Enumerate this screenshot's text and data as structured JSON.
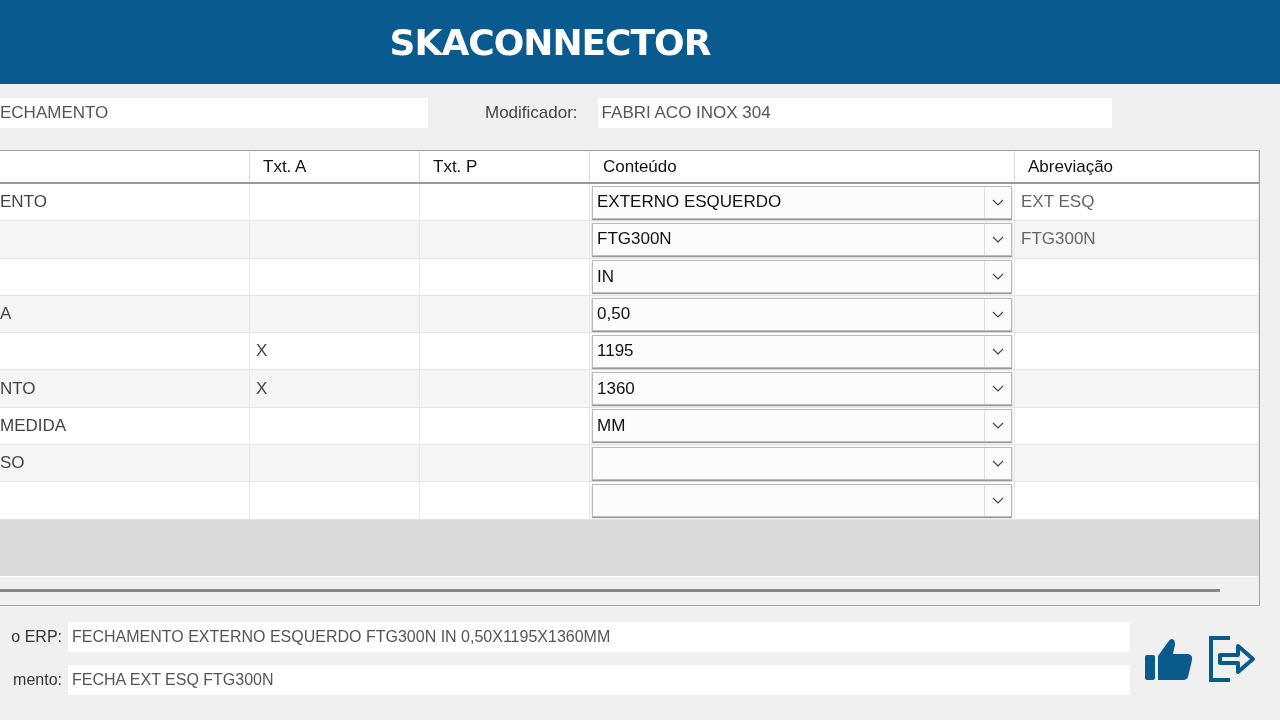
{
  "header": {
    "logo": "SKACONNECTOR"
  },
  "top_fields": [
    {
      "value": "ECHAMENTO"
    },
    {
      "label": "Modificador:",
      "value": "FABRI ACO INOX 304"
    }
  ],
  "grid": {
    "columns": [
      null,
      "Txt. A",
      "Txt. P",
      "Conteúdo",
      "Abreviação"
    ],
    "rows": [
      {
        "column_1": "ENTO",
        "txt_a": "",
        "txt_p": "",
        "conteudo": "EXTERNO ESQUERDO",
        "abreviacao": "EXT ESQ"
      },
      {
        "column_1": "",
        "txt_a": "",
        "txt_p": "",
        "conteudo": "FTG300N",
        "abreviacao": "FTG300N"
      },
      {
        "column_1": "",
        "txt_a": "",
        "txt_p": "",
        "conteudo": "IN",
        "abreviacao": ""
      },
      {
        "column_1": "A",
        "txt_a": "",
        "txt_p": "",
        "conteudo": "0,50",
        "abreviacao": ""
      },
      {
        "column_1": "",
        "txt_a": "X",
        "txt_p": "",
        "conteudo": "1195",
        "abreviacao": ""
      },
      {
        "column_1": "NTO",
        "txt_a": "X",
        "txt_p": "",
        "conteudo": "1360",
        "abreviacao": ""
      },
      {
        "column_1": "MEDIDA",
        "txt_a": "",
        "txt_p": "",
        "conteudo": "MM",
        "abreviacao": ""
      },
      {
        "column_1": "SO",
        "txt_a": "",
        "txt_p": "",
        "conteudo": "",
        "abreviacao": ""
      },
      {
        "column_1": "",
        "txt_a": "",
        "txt_p": "",
        "conteudo": "",
        "abreviacao": ""
      }
    ]
  },
  "bottom_fields": [
    {
      "label": "o ERP:",
      "value": "FECHAMENTO EXTERNO ESQUERDO FTG300N IN 0,50X1195X1360MM"
    },
    {
      "label": "mento:",
      "value": "FECHA EXT ESQ FTG300N"
    }
  ]
}
